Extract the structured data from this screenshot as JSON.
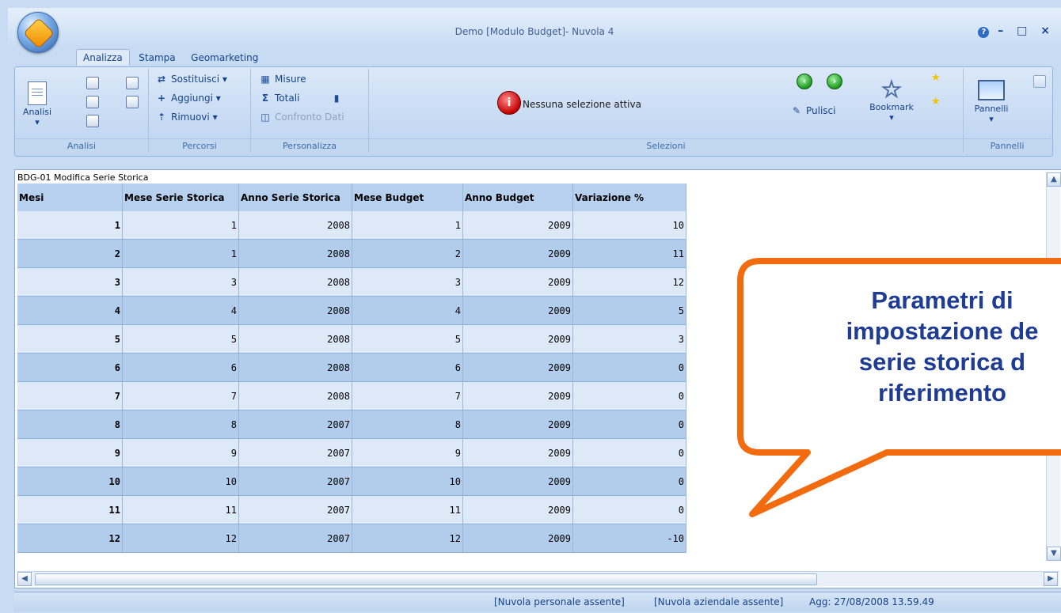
{
  "window": {
    "title": "Demo [Modulo Budget]- Nuvola 4",
    "controls": [
      "?",
      "–",
      "□",
      "×"
    ]
  },
  "tabs": [
    {
      "label": "Analizza",
      "active": true
    },
    {
      "label": "Stampa",
      "active": false
    },
    {
      "label": "Geomarketing",
      "active": false
    }
  ],
  "ribbon": {
    "analisi": {
      "group_label": "Analisi",
      "button_label": "Analisi"
    },
    "percorsi": {
      "group_label": "Percorsi",
      "sostituisci": "Sostituisci",
      "aggiungi": "Aggiungi",
      "rimuovi": "Rimuovi"
    },
    "personalizza": {
      "group_label": "Personalizza",
      "misure": "Misure",
      "totali": "Totali",
      "confronto": "Confronto Dati"
    },
    "selezioni": {
      "group_label": "Selezioni",
      "status": "Nessuna selezione attiva",
      "pulisci": "Pulisci",
      "bookmark": "Bookmark"
    },
    "pannelli": {
      "group_label": "Pannelli",
      "button_label": "Pannelli"
    }
  },
  "grid": {
    "caption": "BDG-01 Modifica Serie Storica",
    "columns": [
      "Mesi",
      "Mese Serie Storica",
      "Anno Serie Storica",
      "Mese Budget",
      "Anno Budget",
      "Variazione %"
    ],
    "rows": [
      [
        "1",
        "1",
        "2008",
        "1",
        "2009",
        "10"
      ],
      [
        "2",
        "1",
        "2008",
        "2",
        "2009",
        "11"
      ],
      [
        "3",
        "3",
        "2008",
        "3",
        "2009",
        "12"
      ],
      [
        "4",
        "4",
        "2008",
        "4",
        "2009",
        "5"
      ],
      [
        "5",
        "5",
        "2008",
        "5",
        "2009",
        "3"
      ],
      [
        "6",
        "6",
        "2008",
        "6",
        "2009",
        "0"
      ],
      [
        "7",
        "7",
        "2008",
        "7",
        "2009",
        "0"
      ],
      [
        "8",
        "8",
        "2007",
        "8",
        "2009",
        "0"
      ],
      [
        "9",
        "9",
        "2007",
        "9",
        "2009",
        "0"
      ],
      [
        "10",
        "10",
        "2007",
        "10",
        "2009",
        "0"
      ],
      [
        "11",
        "11",
        "2007",
        "11",
        "2009",
        "0"
      ],
      [
        "12",
        "12",
        "2007",
        "12",
        "2009",
        "-10"
      ]
    ]
  },
  "callout": {
    "lines": [
      "Parametri di",
      "impostazione de",
      "serie storica d",
      "riferimento"
    ]
  },
  "statusbar": {
    "nuvola_personale": "[Nuvola personale assente]",
    "nuvola_aziendale": "[Nuvola aziendale assente]",
    "aggiornamento": "Agg: 27/08/2008 13.59.49"
  },
  "colors": {
    "accent": "#15428b",
    "callout_border": "#f26b0f",
    "callout_text": "#1f3c95"
  }
}
